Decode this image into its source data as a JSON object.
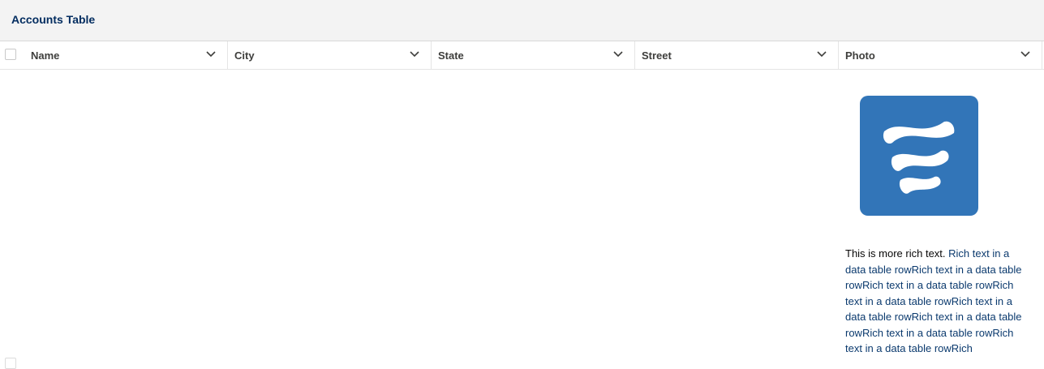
{
  "header": {
    "title": "Accounts Table"
  },
  "columns": [
    {
      "label": "Name"
    },
    {
      "label": "City"
    },
    {
      "label": "State"
    },
    {
      "label": "Street"
    },
    {
      "label": "Photo"
    }
  ],
  "row": {
    "rich_text_plain": "This is more rich text. ",
    "rich_text_link": "Rich text in a data table rowRich text in a data table rowRich text in a data table rowRich text in a data table rowRich text in a data table rowRich text in a data table rowRich text in a data table rowRich text in a data table rowRich",
    "logo_icon": "salesforce-waves-icon"
  },
  "colors": {
    "header_bg": "#f3f3f3",
    "title": "#032d60",
    "logo_tile": "#3275b8",
    "link": "#0b3a6e"
  }
}
